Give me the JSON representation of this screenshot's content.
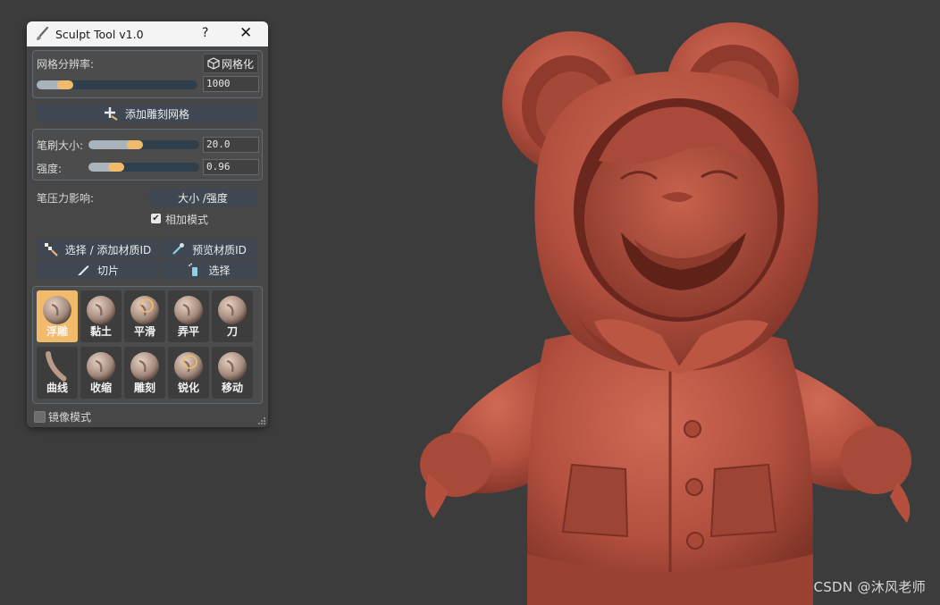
{
  "window": {
    "title": "Sculpt Tool v1.0",
    "help_label": "?",
    "close_label": "✕"
  },
  "mesh": {
    "resolution_label": "网格分辨率:",
    "remesh_label": "网格化",
    "resolution_value": "1000",
    "resolution_fraction": 0.18,
    "add_sculpt_mesh_label": "添加雕刻网格"
  },
  "brush_settings": {
    "size_label": "笔刷大小:",
    "size_value": "20.0",
    "size_fraction": 0.42,
    "strength_label": "强度:",
    "strength_value": "0.96",
    "strength_fraction": 0.25
  },
  "pressure": {
    "label": "笔压力影响:",
    "mode_value": "大小 /强度",
    "additive_label": "相加模式",
    "additive_checked": true
  },
  "material": {
    "select_add_label": "选择 / 添加材质ID",
    "preview_label": "预览材质ID",
    "slice_label": "切片",
    "select_label": "选择"
  },
  "brushes": [
    {
      "name": "浮雕",
      "icon": "relief-brush-icon",
      "active": true
    },
    {
      "name": "黏土",
      "icon": "clay-brush-icon",
      "active": false
    },
    {
      "name": "平滑",
      "icon": "smooth-brush-icon",
      "active": false
    },
    {
      "name": "弄平",
      "icon": "flatten-brush-icon",
      "active": false
    },
    {
      "name": "刀",
      "icon": "knife-brush-icon",
      "active": false
    },
    {
      "name": "曲线",
      "icon": "curve-brush-icon",
      "active": false
    },
    {
      "name": "收缩",
      "icon": "pinch-brush-icon",
      "active": false
    },
    {
      "name": "雕刻",
      "icon": "carve-brush-icon",
      "active": false
    },
    {
      "name": "锐化",
      "icon": "sharpen-brush-icon",
      "active": false
    },
    {
      "name": "移动",
      "icon": "move-brush-icon",
      "active": false
    }
  ],
  "mirror": {
    "label": "镜像模式",
    "checked": false
  },
  "watermark": "CSDN @沐风老师",
  "colors": {
    "accent": "#f2bb6b",
    "viewport_bg": "#3c3c3c",
    "panel_bg": "#474747",
    "model_clay": "#b5503f"
  }
}
